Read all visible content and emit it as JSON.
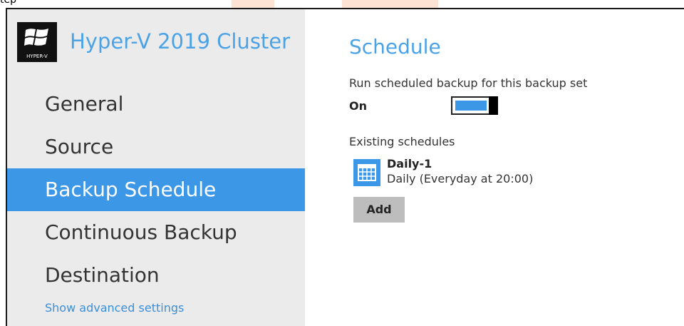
{
  "window": {
    "cut_text": "tep"
  },
  "sidebar": {
    "app_title": "Hyper-V 2019 Cluster",
    "logo_caption": "HYPER-V",
    "items": [
      {
        "label": "General",
        "active": false
      },
      {
        "label": "Source",
        "active": false
      },
      {
        "label": "Backup Schedule",
        "active": true
      },
      {
        "label": "Continuous Backup",
        "active": false
      },
      {
        "label": "Destination",
        "active": false
      }
    ],
    "advanced_link": "Show advanced settings"
  },
  "main": {
    "section_title": "Schedule",
    "run_label": "Run scheduled backup for this backup set",
    "toggle_state": "On",
    "existing_label": "Existing schedules",
    "schedules": [
      {
        "name": "Daily-1",
        "description": "Daily (Everyday at 20:00)"
      }
    ],
    "add_label": "Add"
  },
  "colors": {
    "accent": "#3c97e6",
    "title_blue": "#4ba3e6",
    "sidebar_bg": "#ebebeb",
    "button_bg": "#bdbdbd"
  },
  "icons": [
    "windows-logo-icon",
    "calendar-icon"
  ]
}
